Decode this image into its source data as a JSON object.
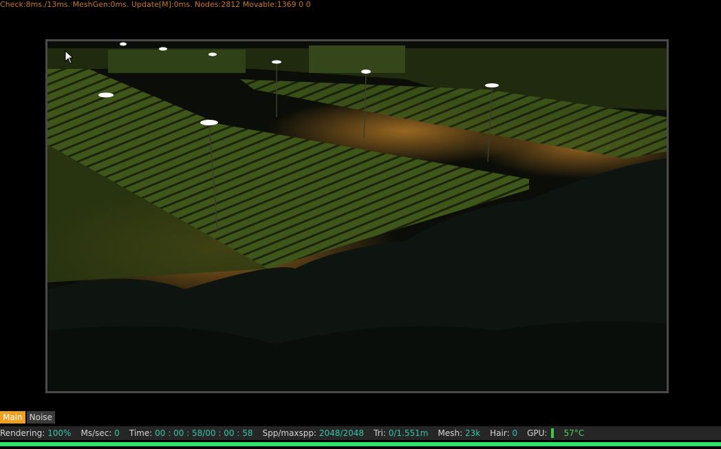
{
  "debug": {
    "text": "Check:8ms./13ms. MeshGen:0ms. Update[M]:0ms. Nodes:2812 Movable:1369  0 0"
  },
  "viewport": {
    "description_icon": "rendered-scene-image"
  },
  "tabs": [
    {
      "label": "Main",
      "active": true
    },
    {
      "label": "Noise",
      "active": false
    }
  ],
  "status": {
    "rendering_label": "Rendering:",
    "rendering_value": "100%",
    "ms_label": "Ms/sec:",
    "ms_value": "0",
    "time_label": "Time:",
    "time_value": "00 : 00 : 58/00 : 00 : 58",
    "spp_label": "Spp/maxspp:",
    "spp_value": "2048/2048",
    "tri_label": "Tri:",
    "tri_value": "0/1.551m",
    "mesh_label": "Mesh:",
    "mesh_value": "23k",
    "hair_label": "Hair:",
    "hair_value": "0",
    "gpu_label": "GPU:",
    "gpu_temp": "57°C"
  },
  "progress": {
    "fraction": 1.0
  },
  "colors": {
    "accent_tab": "#f0a020",
    "value_text": "#33c6a8",
    "progress": "#2ee36a",
    "debug_text": "#c77a2a"
  }
}
